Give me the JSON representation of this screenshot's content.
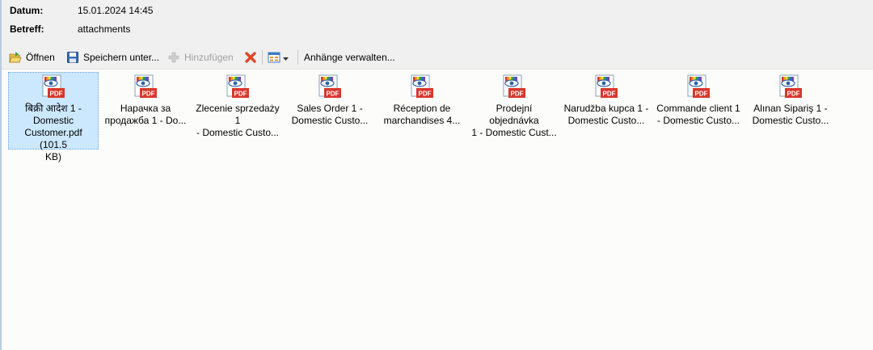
{
  "header": {
    "date_label": "Datum:",
    "date_value": "15.01.2024 14:45",
    "subject_label": "Betreff:",
    "subject_value": "attachments"
  },
  "toolbar": {
    "open": "Öffnen",
    "save": "Speichern unter...",
    "add": "Hinzufügen",
    "manage": "Anhänge verwalten..."
  },
  "attachments": [
    {
      "name_lines": [
        "बिक्री आदेश 1 -",
        "Domestic",
        "Customer.pdf (101.5",
        "KB)"
      ],
      "icon": "pdf-icon"
    },
    {
      "name_lines": [
        "Нарачка за",
        "продажба 1 - Do..."
      ],
      "icon": "pdf-icon"
    },
    {
      "name_lines": [
        "Zlecenie sprzedaży 1",
        "- Domestic Custo..."
      ],
      "icon": "pdf-icon"
    },
    {
      "name_lines": [
        "Sales Order 1 -",
        "Domestic Custo..."
      ],
      "icon": "pdf-icon"
    },
    {
      "name_lines": [
        "Réception de",
        "marchandises 4..."
      ],
      "icon": "pdf-icon"
    },
    {
      "name_lines": [
        "Prodejní objednávka",
        "1 - Domestic Cust..."
      ],
      "icon": "pdf-icon"
    },
    {
      "name_lines": [
        "Narudžba kupca 1 -",
        "Domestic Custo..."
      ],
      "icon": "pdf-icon"
    },
    {
      "name_lines": [
        "Commande client 1",
        "- Domestic Custo..."
      ],
      "icon": "pdf-icon"
    },
    {
      "name_lines": [
        "Alınan Sipariş 1 -",
        "Domestic Custo..."
      ],
      "icon": "pdf-icon"
    }
  ]
}
